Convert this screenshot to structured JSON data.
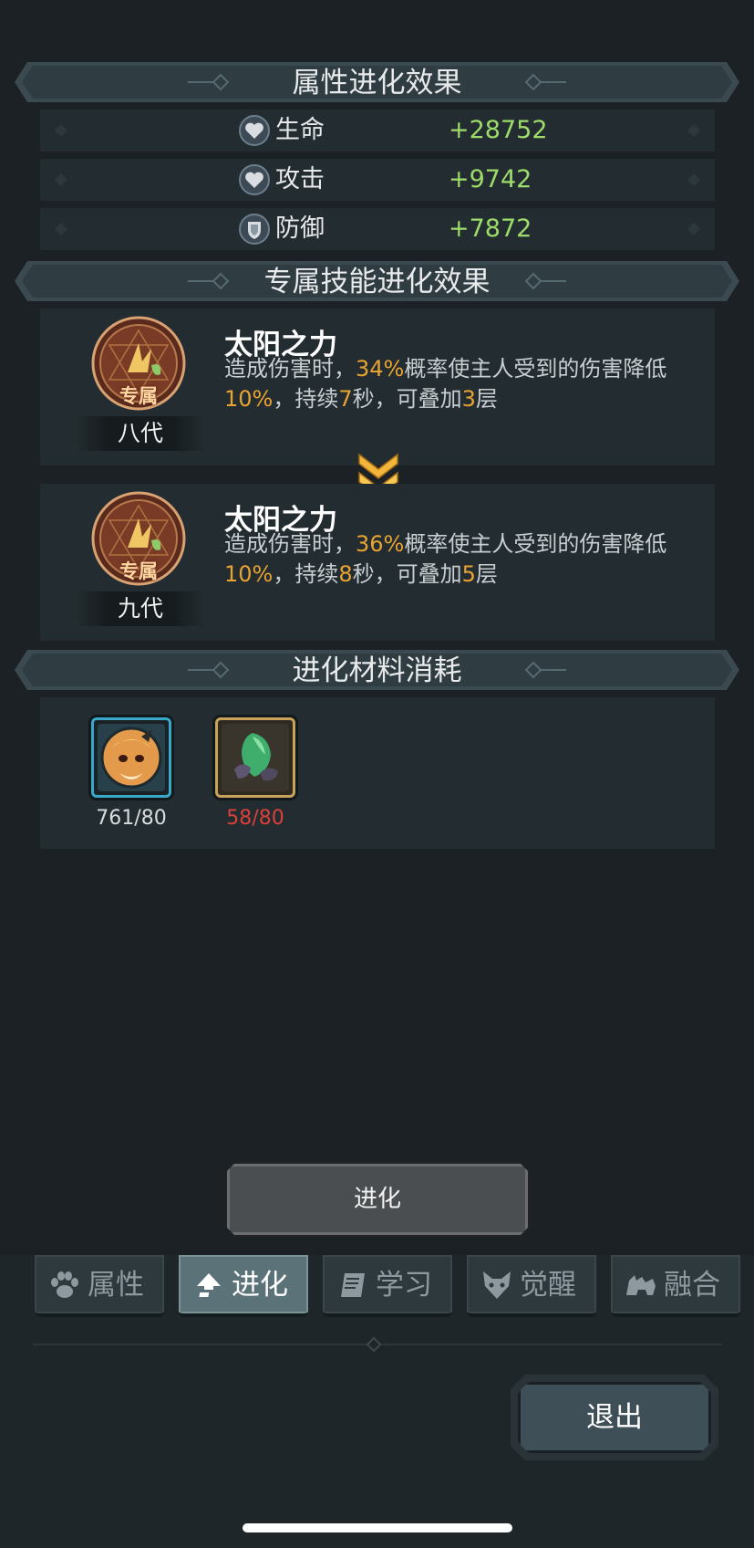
{
  "sections": {
    "attr_title": "属性进化效果",
    "skill_title": "专属技能进化效果",
    "material_title": "进化材料消耗"
  },
  "stats": [
    {
      "icon": "heart-icon",
      "label": "生命",
      "value": "+28752"
    },
    {
      "icon": "heart-icon",
      "label": "攻击",
      "value": "+9742"
    },
    {
      "icon": "shield-icon",
      "label": "防御",
      "value": "+7872"
    }
  ],
  "skills": {
    "before": {
      "badge": "专属",
      "generation": "八代",
      "name": "太阳之力",
      "desc_a": "造成伤害时，",
      "pct": "34%",
      "desc_b": "概率使主人受到的伤害降低",
      "reduce": "10%",
      "desc_c": "，持续",
      "duration": "7",
      "desc_d": "秒，可叠加",
      "stacks": "3",
      "desc_e": "层"
    },
    "after": {
      "badge": "专属",
      "generation": "九代",
      "name": "太阳之力",
      "desc_a": "造成伤害时，",
      "pct": "36%",
      "desc_b": "概率使主人受到的伤害降低",
      "reduce": "10%",
      "desc_c": "，持续",
      "duration": "8",
      "desc_d": "秒，可叠加",
      "stacks": "5",
      "desc_e": "层"
    }
  },
  "materials": [
    {
      "icon": "pet-portrait-icon",
      "count": "761/80",
      "color": "#d8dcde",
      "frame": "#3aa9c9"
    },
    {
      "icon": "green-crystal-icon",
      "count": "58/80",
      "color": "#d9403a",
      "frame": "#c9a35a"
    }
  ],
  "buttons": {
    "evolve": "进化",
    "exit": "退出"
  },
  "tabs": [
    {
      "label": "属性",
      "icon": "paw-icon",
      "active": false
    },
    {
      "label": "进化",
      "icon": "arrow-up-icon",
      "active": true
    },
    {
      "label": "学习",
      "icon": "book-icon",
      "active": false
    },
    {
      "label": "觉醒",
      "icon": "wolf-head-icon",
      "active": false
    },
    {
      "label": "融合",
      "icon": "beast-icon",
      "active": false
    }
  ],
  "colors": {
    "stat_value": "#9ddc6a",
    "highlight": "#e8a332",
    "background": "#1b2124"
  }
}
